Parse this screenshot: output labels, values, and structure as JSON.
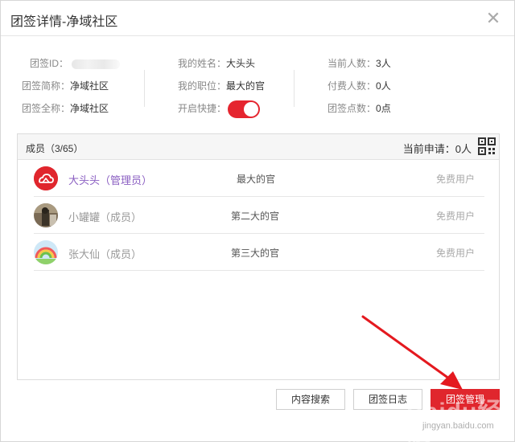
{
  "dialog": {
    "title": "团签详情-净域社区",
    "close_symbol": "✕"
  },
  "info": {
    "id_label": "团签ID：",
    "short_name_label": "团签简称：",
    "short_name_value": "净域社区",
    "full_name_label": "团签全称：",
    "full_name_value": "净域社区",
    "my_name_label": "我的姓名：",
    "my_name_value": "大头头",
    "my_title_label": "我的职位：",
    "my_title_value": "最大的官",
    "shortcut_label": "开启快捷：",
    "shortcut_on": true,
    "current_count_label": "当前人数：",
    "current_count_value": "3人",
    "paid_count_label": "付费人数：",
    "paid_count_value": "0人",
    "points_label": "团签点数：",
    "points_value": "0点"
  },
  "members": {
    "header": "成员（3/65）",
    "apply_label": "当前申请：",
    "apply_value": "0人",
    "list": [
      {
        "name": "大头头（管理员）",
        "title": "最大的官",
        "type": "免费用户",
        "admin": true
      },
      {
        "name": "小罐罐（成员）",
        "title": "第二大的官",
        "type": "免费用户",
        "admin": false
      },
      {
        "name": "张大仙（成员）",
        "title": "第三大的官",
        "type": "免费用户",
        "admin": false
      }
    ]
  },
  "buttons": {
    "search": "内容搜索",
    "log": "团签日志",
    "manage": "团签管理"
  },
  "watermark": {
    "text": "Baidu经验",
    "sub": "jingyan.baidu.com"
  },
  "colors": {
    "accent": "#e0262d",
    "admin_name": "#8b5fc2"
  }
}
